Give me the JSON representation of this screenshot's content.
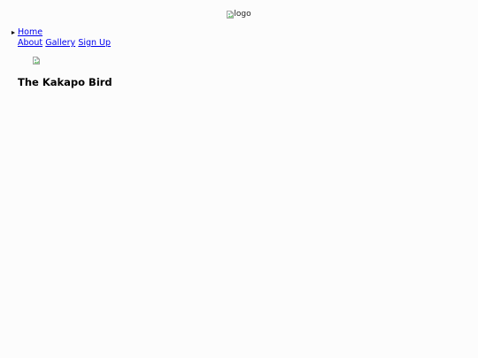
{
  "header": {
    "logo_alt": "logo"
  },
  "nav": {
    "items": [
      {
        "label": "Home"
      },
      {
        "label": "About"
      },
      {
        "label": "Gallery"
      },
      {
        "label": "Sign Up"
      }
    ]
  },
  "main": {
    "title": "The Kakapo Bird"
  }
}
